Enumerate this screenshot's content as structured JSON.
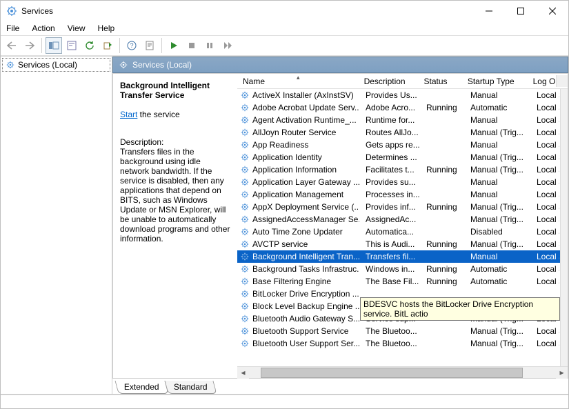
{
  "window": {
    "title": "Services"
  },
  "menu": {
    "file": "File",
    "action": "Action",
    "view": "View",
    "help": "Help"
  },
  "tree": {
    "root": "Services (Local)"
  },
  "pane": {
    "header": "Services (Local)"
  },
  "detail": {
    "title": "Background Intelligent Transfer Service",
    "start_link": "Start",
    "start_suffix": " the service",
    "desc_label": "Description:",
    "desc_text": "Transfers files in the background using idle network bandwidth. If the service is disabled, then any applications that depend on BITS, such as Windows Update or MSN Explorer, will be unable to automatically download programs and other information."
  },
  "columns": {
    "name": "Name",
    "desc": "Description",
    "status": "Status",
    "startup": "Startup Type",
    "logon": "Log On"
  },
  "tabs": {
    "extended": "Extended",
    "standard": "Standard"
  },
  "tooltip": "BDESVC hosts the BitLocker Drive Encryption service. BitL actio",
  "services": [
    {
      "name": "ActiveX Installer (AxInstSV)",
      "desc": "Provides Us...",
      "status": "",
      "startup": "Manual",
      "logon": "Local Sy"
    },
    {
      "name": "Adobe Acrobat Update Serv...",
      "desc": "Adobe Acro...",
      "status": "Running",
      "startup": "Automatic",
      "logon": "Local Sy"
    },
    {
      "name": "Agent Activation Runtime_...",
      "desc": "Runtime for...",
      "status": "",
      "startup": "Manual",
      "logon": "Local Sy"
    },
    {
      "name": "AllJoyn Router Service",
      "desc": "Routes AllJo...",
      "status": "",
      "startup": "Manual (Trig...",
      "logon": "Local Se"
    },
    {
      "name": "App Readiness",
      "desc": "Gets apps re...",
      "status": "",
      "startup": "Manual",
      "logon": "Local Sy"
    },
    {
      "name": "Application Identity",
      "desc": "Determines ...",
      "status": "",
      "startup": "Manual (Trig...",
      "logon": "Local Se"
    },
    {
      "name": "Application Information",
      "desc": "Facilitates t...",
      "status": "Running",
      "startup": "Manual (Trig...",
      "logon": "Local Sy"
    },
    {
      "name": "Application Layer Gateway ...",
      "desc": "Provides su...",
      "status": "",
      "startup": "Manual",
      "logon": "Local Se"
    },
    {
      "name": "Application Management",
      "desc": "Processes in...",
      "status": "",
      "startup": "Manual",
      "logon": "Local Sy"
    },
    {
      "name": "AppX Deployment Service (...",
      "desc": "Provides inf...",
      "status": "Running",
      "startup": "Manual (Trig...",
      "logon": "Local Sy"
    },
    {
      "name": "AssignedAccessManager Se...",
      "desc": "AssignedAc...",
      "status": "",
      "startup": "Manual (Trig...",
      "logon": "Local Sy"
    },
    {
      "name": "Auto Time Zone Updater",
      "desc": "Automatica...",
      "status": "",
      "startup": "Disabled",
      "logon": "Local Se"
    },
    {
      "name": "AVCTP service",
      "desc": "This is Audi...",
      "status": "Running",
      "startup": "Manual (Trig...",
      "logon": "Local Se"
    },
    {
      "name": "Background Intelligent Tran...",
      "desc": "Transfers fil...",
      "status": "",
      "startup": "Manual",
      "logon": "Local Sy",
      "selected": true
    },
    {
      "name": "Background Tasks Infrastruc...",
      "desc": "Windows in...",
      "status": "Running",
      "startup": "Automatic",
      "logon": "Local Sy"
    },
    {
      "name": "Base Filtering Engine",
      "desc": "The Base Fil...",
      "status": "Running",
      "startup": "Automatic",
      "logon": "Local Se"
    },
    {
      "name": "BitLocker Drive Encryption ...",
      "desc": "",
      "status": "",
      "startup": "",
      "logon": ""
    },
    {
      "name": "Block Level Backup Engine ...",
      "desc": "",
      "status": "",
      "startup": "",
      "logon": ""
    },
    {
      "name": "Bluetooth Audio Gateway S...",
      "desc": "Service sup...",
      "status": "",
      "startup": "Manual (Trig...",
      "logon": "Local Se"
    },
    {
      "name": "Bluetooth Support Service",
      "desc": "The Bluetoo...",
      "status": "",
      "startup": "Manual (Trig...",
      "logon": "Local Se"
    },
    {
      "name": "Bluetooth User Support Ser...",
      "desc": "The Bluetoo...",
      "status": "",
      "startup": "Manual (Trig...",
      "logon": "Local Sy"
    }
  ]
}
